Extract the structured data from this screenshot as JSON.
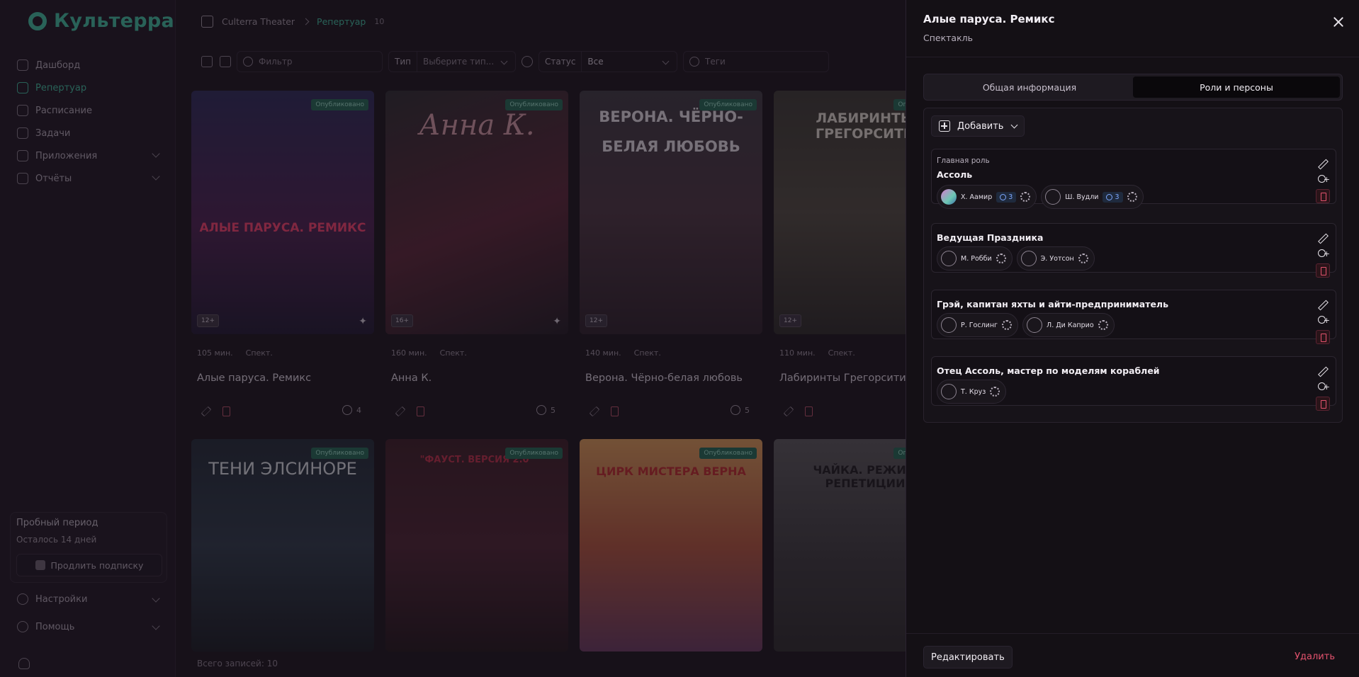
{
  "app": {
    "logo": "Культерра"
  },
  "sidebar": {
    "items": [
      {
        "label": "Дашборд",
        "icon": "dashboard-icon"
      },
      {
        "label": "Репертуар",
        "icon": "repertoire-icon",
        "active": true
      },
      {
        "label": "Расписание",
        "icon": "calendar-icon"
      },
      {
        "label": "Задачи",
        "icon": "tasks-icon"
      },
      {
        "label": "Приложения",
        "icon": "apps-icon"
      },
      {
        "label": "Отчёты",
        "icon": "reports-icon"
      }
    ],
    "trial": {
      "title": "Пробный период",
      "days_left": "Осталось 14 дней",
      "renew_label": "Продлить подписку"
    },
    "settings_label": "Настройки",
    "help_label": "Помощь"
  },
  "breadcrumb": {
    "org": "Culterra Theater",
    "section": "Репертуар",
    "count": "10"
  },
  "filters": {
    "search_placeholder": "Фильтр",
    "type_label": "Тип",
    "type_placeholder": "Выберите тип...",
    "status_label": "Статус",
    "status_value": "Все",
    "tags_placeholder": "Теги"
  },
  "cards": [
    {
      "poster_text": "АЛЫЕ ПАРУСА. РЕМИКС",
      "status": "Опубликовано",
      "age": "12+",
      "duration": "105 мин.",
      "kind": "Спект.",
      "title": "Алые паруса. Ремикс",
      "people": "4"
    },
    {
      "poster_text": "Анна К.",
      "status": "Опубликовано",
      "age": "16+",
      "duration": "160 мин.",
      "kind": "Спект.",
      "title": "Анна К.",
      "people": "5"
    },
    {
      "poster_text": "ВЕРОНА. ЧЁРНО-БЕЛАЯ ЛЮБОВЬ",
      "status": "Опубликовано",
      "age": "12+",
      "duration": "140 мин.",
      "kind": "Спект.",
      "title": "Верона. Чёрно-белая любовь",
      "people": "5"
    },
    {
      "poster_text": "ЛАБИРИНТЫ ГРЕГОРСИТИ",
      "status": "Опубликовано",
      "age": "12+",
      "duration": "110 мин.",
      "kind": "Спект.",
      "title": "Лабиринты Грегорсити",
      "people": ""
    },
    {
      "poster_text": "ТЕНИ ЭЛСИНОРЕ",
      "status": "Опубликовано"
    },
    {
      "poster_text": "\"ФАУСТ. ВЕРСИЯ 2.0\"",
      "status": "Опубликовано"
    },
    {
      "poster_text": "ЦИРК МИСТЕРА ВЕРНА",
      "status": "Опубликовано"
    },
    {
      "poster_text": "ЧАЙКА. РЕЖИМ РЕПЕТИЦИИ",
      "status": "Опубликовано"
    }
  ],
  "total": "Всего записей: 10",
  "drawer": {
    "title": "Алые паруса. Ремикс",
    "subtitle": "Спектакль",
    "tabs": [
      {
        "label": "Общая информация",
        "active": false
      },
      {
        "label": "Роли и персоны",
        "active": true
      }
    ],
    "add_label": "Добавить",
    "roles": [
      {
        "tag": "Главная роль",
        "name": "Ассоль",
        "performers": [
          {
            "name": "Х. Аамир",
            "rating": "3",
            "photo": true
          },
          {
            "name": "Ш. Вудли",
            "rating": "3",
            "photo": false
          }
        ]
      },
      {
        "tag": "",
        "name": "Ведущая Праздника",
        "performers": [
          {
            "name": "М. Робби",
            "rating": "",
            "photo": false
          },
          {
            "name": "Э. Уотсон",
            "rating": "",
            "photo": false
          }
        ]
      },
      {
        "tag": "",
        "name": "Грэй, капитан яхты и айти-предприниматель",
        "performers": [
          {
            "name": "Р. Гослинг",
            "rating": "",
            "photo": false
          },
          {
            "name": "Л. Ди Каприо",
            "rating": "",
            "photo": false
          }
        ]
      },
      {
        "tag": "",
        "name": "Отец Ассоль, мастер по моделям кораблей",
        "performers": [
          {
            "name": "Т. Круз",
            "rating": "",
            "photo": false
          }
        ]
      }
    ],
    "edit_label": "Редактировать",
    "delete_label": "Удалить"
  },
  "colors": {
    "accent": "#3ec6a4",
    "danger": "#e4536e",
    "published": "#1f6a55",
    "rating": "#7fa8ff"
  }
}
